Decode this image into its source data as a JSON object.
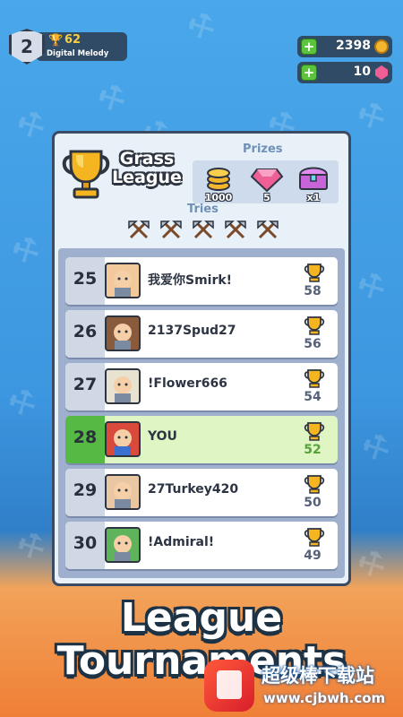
{
  "profile": {
    "level": "2",
    "trophies": "62",
    "name": "Digital Melody"
  },
  "currency": {
    "coins": "2398",
    "gems": "10"
  },
  "league": {
    "title": "Grass League",
    "prizes_label": "Prizes",
    "prizes": [
      {
        "icon": "coin-stack-icon",
        "value": "1000"
      },
      {
        "icon": "gem-icon",
        "value": "5"
      },
      {
        "icon": "treasure-chest-icon",
        "value": "x1"
      }
    ],
    "tries_label": "Tries",
    "tries_count": 5
  },
  "leaderboard": [
    {
      "rank": "25",
      "name": "我爱你Smirk!",
      "score": "58",
      "you": false
    },
    {
      "rank": "26",
      "name": "2137Spud27",
      "score": "56",
      "you": false
    },
    {
      "rank": "27",
      "name": "!Flower666",
      "score": "54",
      "you": false
    },
    {
      "rank": "28",
      "name": "YOU",
      "score": "52",
      "you": true
    },
    {
      "rank": "29",
      "name": "27Turkey420",
      "score": "50",
      "you": false
    },
    {
      "rank": "30",
      "name": "!Admiral!",
      "score": "49",
      "you": false
    }
  ],
  "headline": {
    "line1": "League",
    "line2": "Tournaments"
  },
  "watermark": {
    "text1": "超级棒下载站",
    "text2": "www.cjbwh.com"
  },
  "colors": {
    "accent_green": "#55b944",
    "panel_border": "#3b4b63",
    "gold": "#f3b62d"
  }
}
